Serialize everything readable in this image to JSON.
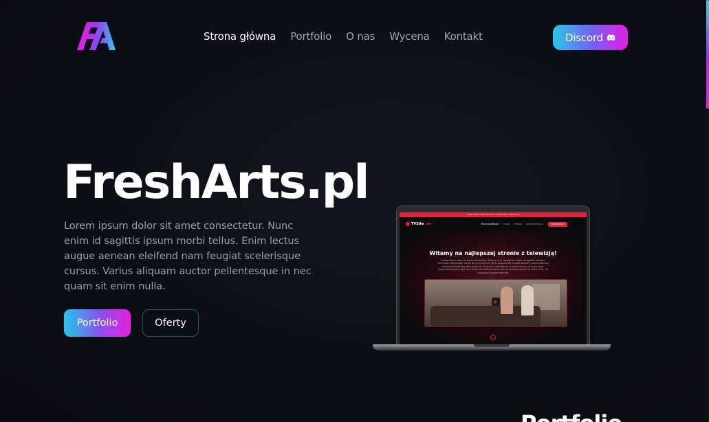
{
  "header": {
    "logo_text": "FA",
    "nav": [
      {
        "label": "Strona główna",
        "active": true
      },
      {
        "label": "Portfolio",
        "active": false
      },
      {
        "label": "O nas",
        "active": false
      },
      {
        "label": "Wycena",
        "active": false
      },
      {
        "label": "Kontakt",
        "active": false
      }
    ],
    "discord_label": "Discord",
    "discord_icon": "discord-icon"
  },
  "hero": {
    "title": "FreshArts.pl",
    "description": "Lorem ipsum dolor sit amet consectetur. Nunc enim id sagittis ipsum morbi tellus. Enim lectus augue aenean eleifend nam feugiat scelerisque cursus. Varius aliquam auctor pellentesque in nec quam sit enim nulla.",
    "primary_button": "Portfolio",
    "secondary_button": "Oferty"
  },
  "laptop_preview": {
    "topbar": "Lorem ipsum dolor sit amet consectetur adipiscing",
    "logo": "TVSite",
    "logo_tld": ".eu",
    "links": [
      "Strona główna",
      "O nas",
      "Oferta",
      "Administracja"
    ],
    "login": "Logowanie",
    "heading": "Witamy na najlepszej stronie z telewizją!",
    "body": "Lorem ipsum dolor sit amet consectetur. Tempor ut in feugiat leo. Nibh volutpat et aliquam commodo ullamcorper metus at nec tincidunt. Tellus posuere elit feugiat aliquam. Lectus aliquam tincidunt feugiat faucibus morbi sit. Ut ipsum commodo in ut mollis tempus at enim amet. Suspendisse lorem eget arcu tellus nec ultrices morbi. Hac at faucibus gravida et tellus nunc. Sit consequat aliquam gravida.",
    "play_icon": "play-icon"
  },
  "next_section": {
    "title": "Portfolio"
  },
  "colors": {
    "gradient_start": "#2bc7e8",
    "gradient_end": "#e61fe3",
    "preview_accent": "#e3213d",
    "background": "#0d0e15"
  }
}
